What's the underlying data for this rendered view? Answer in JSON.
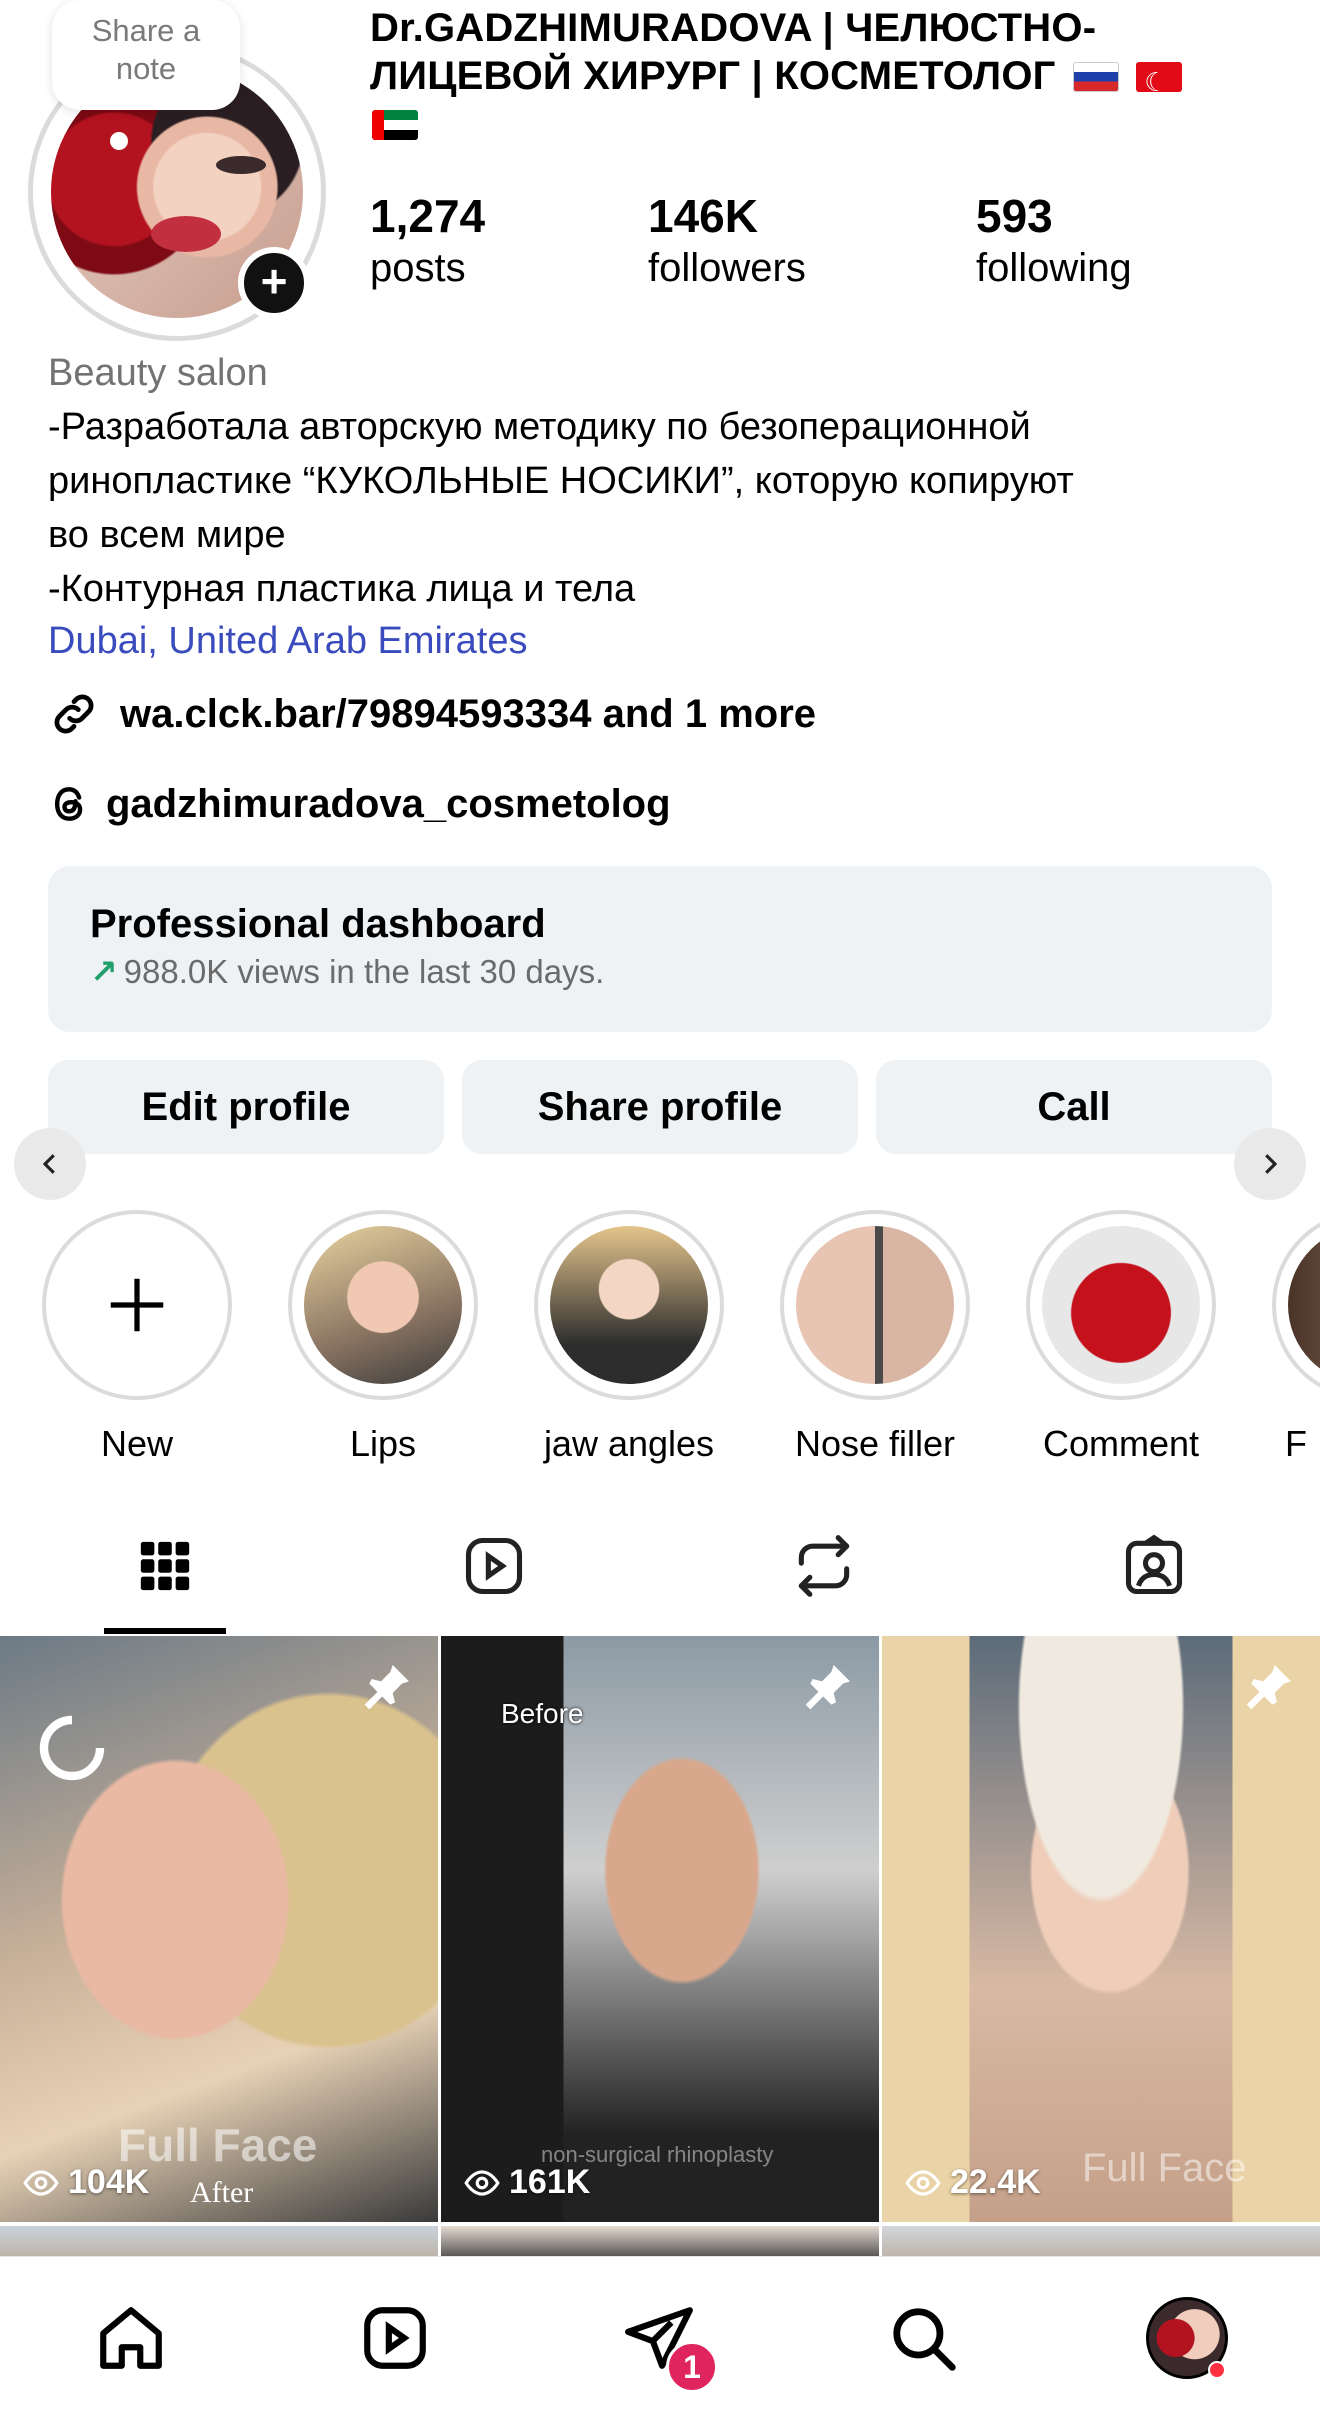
{
  "profile": {
    "note_text": "Share a\nnote",
    "name_line1": "Dr.GADZHIMURADOVA |  ЧЕЛЮСТНО-",
    "name_line2": "ЛИЦЕВОЙ ХИРУРГ | КОСМЕТОЛОГ",
    "flags": [
      "russia-flag",
      "turkey-flag",
      "uae-flag"
    ]
  },
  "stats": [
    {
      "value": "1,274",
      "label": "posts"
    },
    {
      "value": "146K",
      "label": "followers"
    },
    {
      "value": "593",
      "label": "following"
    }
  ],
  "bio": {
    "category": "Beauty salon",
    "line1": "-Разработала авторскую методику по безоперационной",
    "line2": "ринопластике “КУКОЛЬНЫЕ НОСИКИ”, которую копируют",
    "line3": "во всем мире",
    "line4": "-Контурная пластика лица и тела",
    "location": "Dubai, United Arab Emirates",
    "link": "wa.clck.bar/79894593334 and 1 more",
    "threads": "gadzhimuradova_cosmetolog"
  },
  "dashboard": {
    "title": "Professional dashboard",
    "arrow": "↗",
    "subtitle": "988.0K views in the last 30 days."
  },
  "buttons": {
    "edit": "Edit profile",
    "share": "Share profile",
    "call": "Call"
  },
  "highlights": [
    {
      "label": "New"
    },
    {
      "label": "Lips"
    },
    {
      "label": "jaw angles"
    },
    {
      "label": "Nose filler"
    },
    {
      "label": "Comment"
    },
    {
      "label": "F"
    }
  ],
  "tabs": [
    "grid-icon",
    "reels-icon",
    "reposts-icon",
    "tagged-icon"
  ],
  "posts": [
    {
      "views": "104K",
      "overlay": "Full Face",
      "overlay2": "After"
    },
    {
      "views": "161K",
      "overlay": "Before",
      "overlay2": "non-surgical rhinoplasty"
    },
    {
      "views": "22.4K",
      "overlay": "Full Face"
    }
  ],
  "nav": {
    "notification_count": "1"
  },
  "colors": {
    "link_blue": "#3a4bbd",
    "button_bg": "#eff2f5",
    "badge_red": "#e0245e",
    "trend_green": "#22a06b"
  }
}
